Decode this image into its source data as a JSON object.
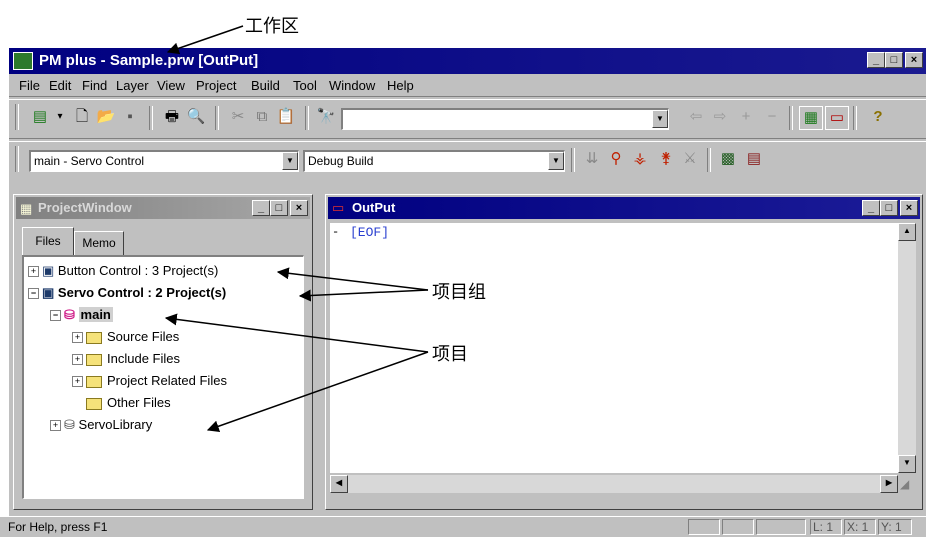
{
  "annotations": {
    "workspace": "工作区",
    "project_group": "项目组",
    "project": "项目"
  },
  "window": {
    "title": "PM plus - Sample.prw [OutPut]",
    "controls": [
      "_",
      "□",
      "×"
    ]
  },
  "menu": {
    "items": [
      "File",
      "Edit",
      "Find",
      "Layer",
      "View",
      "Project",
      "Build",
      "Tool",
      "Window",
      "Help"
    ]
  },
  "toolbar2": {
    "project_combo": "main - Servo Control",
    "build_combo": "Debug Build"
  },
  "project_window": {
    "title": "ProjectWindow",
    "tabs": [
      "Files",
      "Memo"
    ],
    "tree": [
      {
        "label": "Button Control : 3 Project(s)",
        "bold": false
      },
      {
        "label": "Servo Control : 2 Project(s)",
        "bold": true
      },
      {
        "label": "main",
        "bold": true
      },
      {
        "label": "Source Files"
      },
      {
        "label": "Include Files"
      },
      {
        "label": "Project Related Files"
      },
      {
        "label": "Other Files"
      },
      {
        "label": "ServoLibrary"
      }
    ]
  },
  "output_window": {
    "title": "OutPut",
    "content": "[EOF]"
  },
  "statusbar": {
    "help_text": "For Help, press F1",
    "line": "L: 1",
    "x": "X: 1",
    "y": "Y: 1"
  },
  "colors": {
    "titlebar": "#000080",
    "face": "#c0c0c0",
    "output_text": "#2a3fd0"
  }
}
